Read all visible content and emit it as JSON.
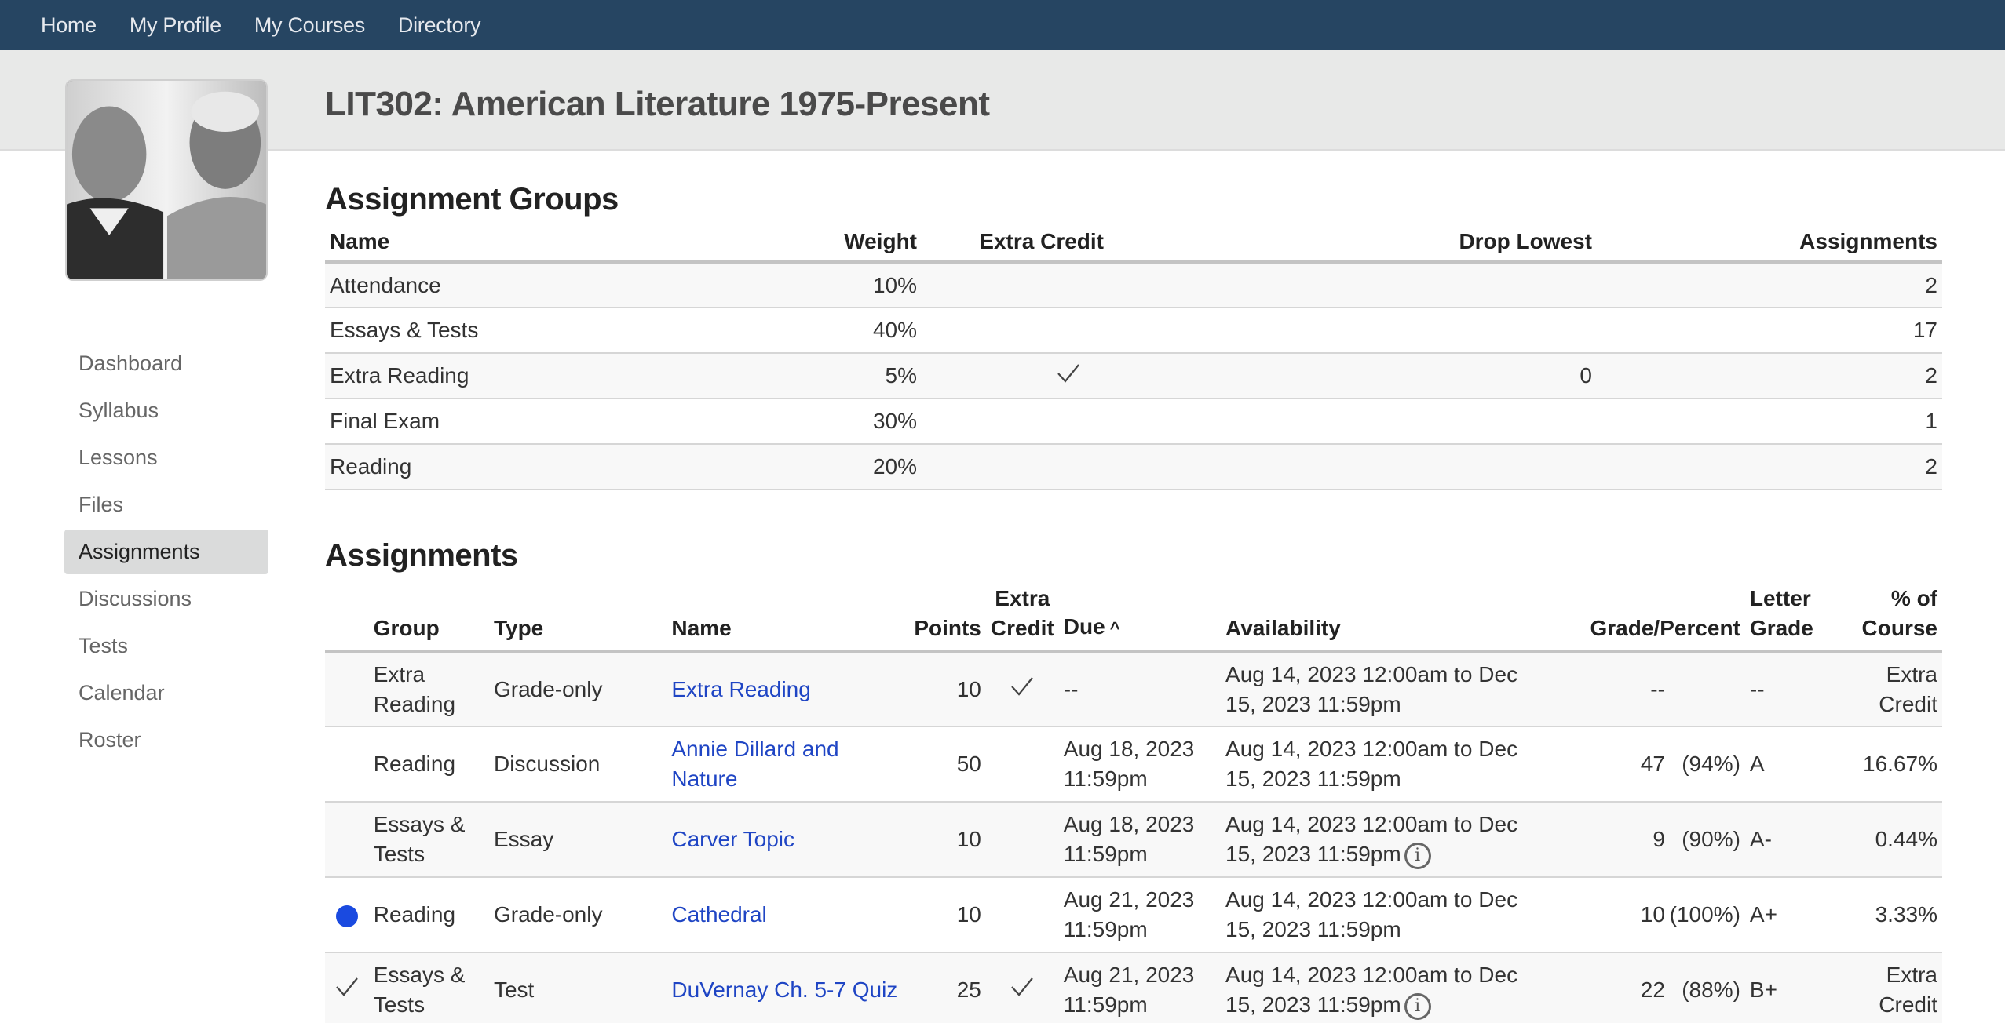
{
  "topnav": {
    "items": [
      "Home",
      "My Profile",
      "My Courses",
      "Directory"
    ]
  },
  "course": {
    "title": "LIT302: American Literature 1975-Present",
    "image_alt": "course-banner-portraits"
  },
  "sidebar": {
    "items": [
      {
        "label": "Dashboard",
        "active": false
      },
      {
        "label": "Syllabus",
        "active": false
      },
      {
        "label": "Lessons",
        "active": false
      },
      {
        "label": "Files",
        "active": false
      },
      {
        "label": "Assignments",
        "active": true
      },
      {
        "label": "Discussions",
        "active": false
      },
      {
        "label": "Tests",
        "active": false
      },
      {
        "label": "Calendar",
        "active": false
      },
      {
        "label": "Roster",
        "active": false
      }
    ]
  },
  "groups": {
    "title": "Assignment Groups",
    "headers": {
      "name": "Name",
      "weight": "Weight",
      "extra_credit": "Extra Credit",
      "drop_lowest": "Drop Lowest",
      "assignments": "Assignments"
    },
    "rows": [
      {
        "name": "Attendance",
        "weight": "10%",
        "extra_credit": false,
        "drop_lowest": "",
        "assignments": "2"
      },
      {
        "name": "Essays & Tests",
        "weight": "40%",
        "extra_credit": false,
        "drop_lowest": "",
        "assignments": "17"
      },
      {
        "name": "Extra Reading",
        "weight": "5%",
        "extra_credit": true,
        "drop_lowest": "0",
        "assignments": "2"
      },
      {
        "name": "Final Exam",
        "weight": "30%",
        "extra_credit": false,
        "drop_lowest": "",
        "assignments": "1"
      },
      {
        "name": "Reading",
        "weight": "20%",
        "extra_credit": false,
        "drop_lowest": "",
        "assignments": "2"
      }
    ]
  },
  "assignments": {
    "title": "Assignments",
    "headers": {
      "group": "Group",
      "type": "Type",
      "name": "Name",
      "points": "Points",
      "extra_credit_1": "Extra",
      "extra_credit_2": "Credit",
      "due": "Due",
      "due_sort_icon": "^",
      "availability": "Availability",
      "grade_percent": "Grade/Percent",
      "letter_1": "Letter",
      "letter_2": "Grade",
      "course_pct_1": "% of",
      "course_pct_2": "Course"
    },
    "rows": [
      {
        "status": "none",
        "group": "Extra Reading",
        "type": "Grade-only",
        "name": "Extra Reading",
        "points": "10",
        "extra_credit": true,
        "due": "--",
        "availability": "Aug 14, 2023 12:00am to Dec 15, 2023 11:59pm",
        "info": false,
        "grade": "--",
        "percent": "",
        "letter": "--",
        "course_pct": "Extra Credit"
      },
      {
        "status": "none",
        "group": "Reading",
        "type": "Discussion",
        "name": "Annie Dillard and Nature",
        "points": "50",
        "extra_credit": false,
        "due": "Aug 18, 2023 11:59pm",
        "availability": "Aug 14, 2023 12:00am to Dec 15, 2023 11:59pm",
        "info": false,
        "grade": "47",
        "percent": "(94%)",
        "letter": "A",
        "course_pct": "16.67%"
      },
      {
        "status": "none",
        "group": "Essays & Tests",
        "type": "Essay",
        "name": "Carver Topic",
        "points": "10",
        "extra_credit": false,
        "due": "Aug 18, 2023 11:59pm",
        "availability": "Aug 14, 2023 12:00am to Dec 15, 2023 11:59pm",
        "info": true,
        "grade": "9",
        "percent": "(90%)",
        "letter": "A-",
        "course_pct": "0.44%"
      },
      {
        "status": "new",
        "group": "Reading",
        "type": "Grade-only",
        "name": "Cathedral",
        "points": "10",
        "extra_credit": false,
        "due": "Aug 21, 2023 11:59pm",
        "availability": "Aug 14, 2023 12:00am to Dec 15, 2023 11:59pm",
        "info": false,
        "grade": "10",
        "percent": "(100%)",
        "letter": "A+",
        "course_pct": "3.33%"
      },
      {
        "status": "done",
        "group": "Essays & Tests",
        "type": "Test",
        "name": "DuVernay Ch. 5-7 Quiz",
        "points": "25",
        "extra_credit": true,
        "due": "Aug 21, 2023 11:59pm",
        "availability": "Aug 14, 2023 12:00am to Dec 15, 2023 11:59pm",
        "info": true,
        "grade": "22",
        "percent": "(88%)",
        "letter": "B+",
        "course_pct": "Extra Credit"
      }
    ]
  },
  "colors": {
    "nav_bg": "#264562",
    "link": "#1f45c4",
    "status_dot": "#1a4ae0",
    "active_sidebar_bg": "#dadbdb"
  }
}
